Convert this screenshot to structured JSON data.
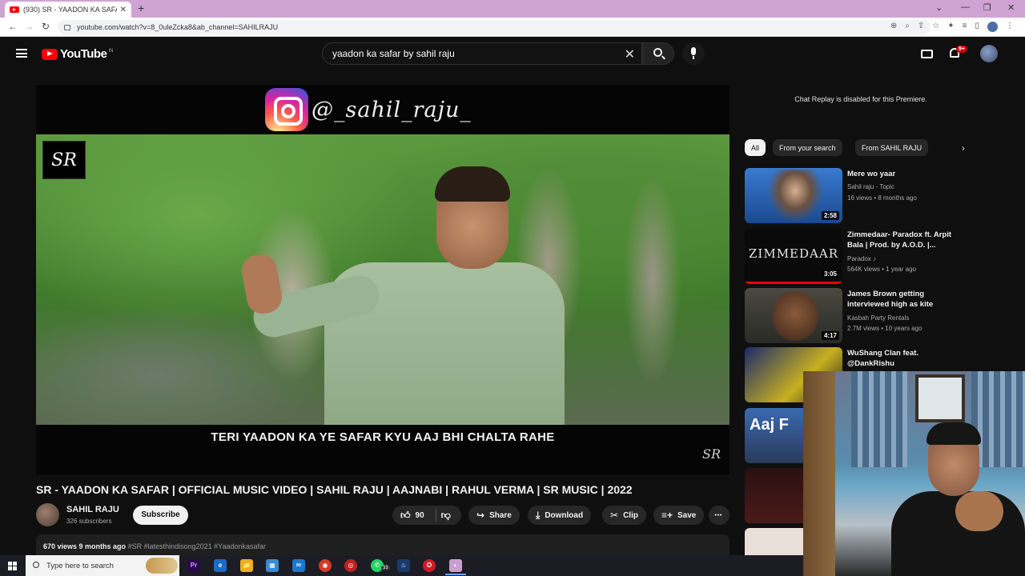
{
  "browser": {
    "tab_title": "(930) SR - YAADON KA SAFAR",
    "tab_close": "✕",
    "new_tab": "+",
    "url": "youtube.com/watch?v=8_0uleZcka8&ab_channel=SAHILRAJU",
    "window_controls": [
      "⌄",
      "—",
      "❐",
      "✕"
    ]
  },
  "header": {
    "logo_text": "YouTube",
    "country_code": "IN",
    "search_query": "yaadon ka safar by sahil raju",
    "notification_count": "9+"
  },
  "player": {
    "instagram_handle": "@_sahil_raju_",
    "logo_mark": "SR",
    "lyric": "TERI YAADON KA YE SAFAR KYU AAJ BHI CHALTA RAHE",
    "watermark": "SR"
  },
  "video": {
    "title": "SR - YAADON KA SAFAR | OFFICIAL MUSIC VIDEO | SAHIL RAJU | AAJNABI | RAHUL VERMA | SR MUSIC | 2022",
    "channel_name": "SAHIL RAJU",
    "subscribers": "326 subscribers",
    "subscribe_label": "Subscribe",
    "likes": "90",
    "share_label": "Share",
    "download_label": "Download",
    "clip_label": "Clip",
    "save_label": "Save",
    "more_label": "⋯",
    "views_date": "670 views  9 months ago",
    "hashtags": "#SR #latesthindisong2021 #Yaadonkasafar"
  },
  "sidebar": {
    "chat_replay": "Chat Replay is disabled for this Premiere.",
    "chips": [
      "All",
      "From your search",
      "From SAHIL RAJU"
    ],
    "chip_next": "›",
    "recommendations": [
      {
        "title": "Mere wo yaar",
        "channel": "Sahil raju - Topic",
        "meta": "16 views • 8 months ago",
        "duration": "2:58"
      },
      {
        "title": "Zimmedaar- Paradox ft. Arpit Bala | Prod. by A.O.D. |...",
        "channel": "Paradox ♪",
        "meta": "564K views • 1 year ago",
        "duration": "3:05",
        "thumb_text": "ZIMMEDAAR",
        "watched_fraction": 1.0
      },
      {
        "title": "James Brown getting interviewed high as kite",
        "channel": "Kasbah Party Rentals",
        "meta": "2.7M views • 10 years ago",
        "duration": "4:17"
      },
      {
        "title": "WuShang Clan feat. @DankRishu",
        "channel": "",
        "meta": ""
      }
    ],
    "thumb_partial_text": "Aaj F"
  },
  "taskbar": {
    "search_placeholder": "Type here to search",
    "apps": [
      "Pr",
      "e",
      "📁",
      "▦",
      "✉",
      "◉",
      "◎",
      "✆",
      "♨",
      "O",
      "◐"
    ],
    "whatsapp_badge": "33"
  },
  "colors": {
    "accent": "#ff0000",
    "background": "#0f0f0f",
    "pill": "#272727",
    "tab_bar": "#cfa3d4"
  }
}
